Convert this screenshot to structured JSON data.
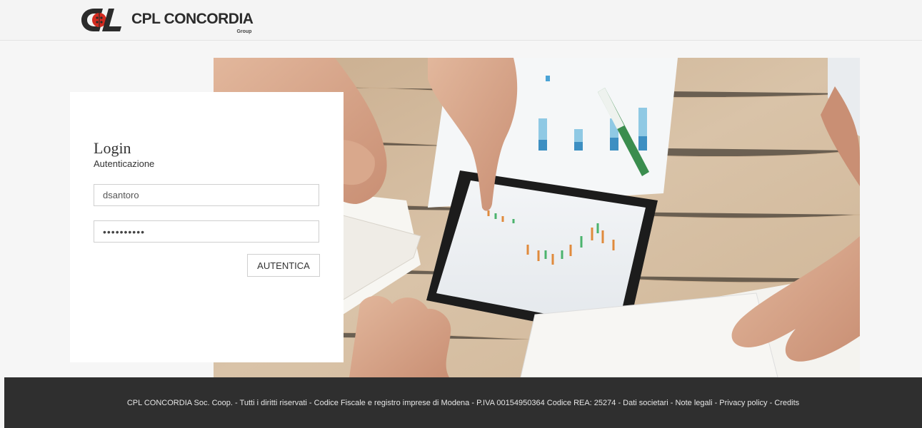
{
  "header": {
    "logo_name": "CPL CONCORDIA",
    "logo_group": "Group"
  },
  "login": {
    "title": "Login",
    "subtitle": "Autenticazione",
    "username_value": "dsantoro",
    "password_value": "••••••••••",
    "submit_label": "AUTENTICA"
  },
  "footer": {
    "company": "CPL CONCORDIA Soc. Coop.",
    "rights": "Tutti i diritti riservati",
    "registry": "Codice Fiscale e registro imprese di Modena",
    "vat": "P.IVA 00154950364 Codice REA: 25274",
    "sep": " - ",
    "links": [
      "Dati societari",
      "Note legali",
      "Privacy policy",
      "Credits"
    ]
  },
  "colors": {
    "footer_bg": "#2f2f2f",
    "logo_red": "#d32a1f",
    "logo_dark": "#2b2b2b"
  }
}
